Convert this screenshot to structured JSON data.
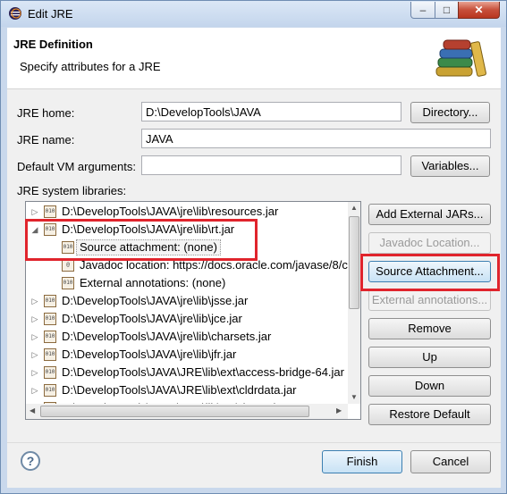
{
  "window": {
    "title": "Edit JRE",
    "minimize_glyph": "–",
    "maximize_glyph": "□",
    "close_glyph": "✕"
  },
  "header": {
    "title": "JRE Definition",
    "subtitle": "Specify attributes for a JRE"
  },
  "form": {
    "jre_home_label": "JRE home:",
    "jre_home_value": "D:\\DevelopTools\\JAVA",
    "directory_button": "Directory...",
    "jre_name_label": "JRE name:",
    "jre_name_value": "JAVA",
    "vm_args_label": "Default VM arguments:",
    "vm_args_value": "",
    "variables_button": "Variables...",
    "libs_label": "JRE system libraries:"
  },
  "libraries": [
    {
      "path": "D:\\DevelopTools\\JAVA\\jre\\lib\\resources.jar",
      "expanded": false
    },
    {
      "path": "D:\\DevelopTools\\JAVA\\jre\\lib\\rt.jar",
      "expanded": true,
      "children": [
        {
          "label": "Source attachment: (none)"
        },
        {
          "label": "Javadoc location: https://docs.oracle.com/javase/8/c"
        },
        {
          "label": "External annotations: (none)"
        }
      ]
    },
    {
      "path": "D:\\DevelopTools\\JAVA\\jre\\lib\\jsse.jar",
      "expanded": false
    },
    {
      "path": "D:\\DevelopTools\\JAVA\\jre\\lib\\jce.jar",
      "expanded": false
    },
    {
      "path": "D:\\DevelopTools\\JAVA\\jre\\lib\\charsets.jar",
      "expanded": false
    },
    {
      "path": "D:\\DevelopTools\\JAVA\\jre\\lib\\jfr.jar",
      "expanded": false
    },
    {
      "path": "D:\\DevelopTools\\JAVA\\JRE\\lib\\ext\\access-bridge-64.jar",
      "expanded": false
    },
    {
      "path": "D:\\DevelopTools\\JAVA\\JRE\\lib\\ext\\cldrdata.jar",
      "expanded": false
    },
    {
      "path": "D:\\DevelopTools\\JAVA\\JRE\\lib\\ext\\dnsns.jar",
      "expanded": false
    }
  ],
  "side_buttons": {
    "add_external_jars": "Add External JARs...",
    "javadoc_location": "Javadoc Location...",
    "source_attachment": "Source Attachment...",
    "external_annotations": "External annotations...",
    "remove": "Remove",
    "up": "Up",
    "down": "Down",
    "restore_default": "Restore Default"
  },
  "footer": {
    "help_glyph": "?",
    "finish": "Finish",
    "cancel": "Cancel"
  },
  "icons": {
    "jar_glyph": "010"
  },
  "colors": {
    "highlight_red": "#e0242c",
    "titlebar": "#c9d8ec",
    "focus_blue": "#3c7fb1"
  }
}
